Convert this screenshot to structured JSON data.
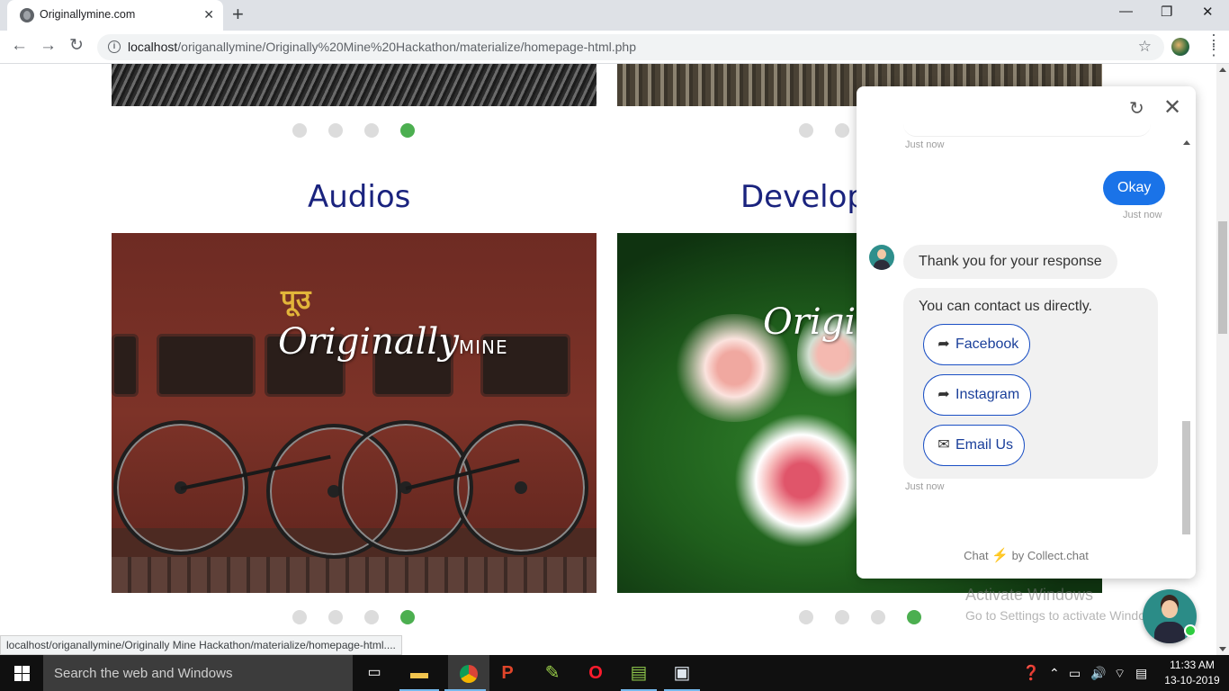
{
  "browser": {
    "tab_title": "Originallymine.com",
    "tab_close": "✕",
    "new_tab": "+",
    "url_host": "localhost",
    "url_path": "/origanallymine/Originally%20Mine%20Hackathon/materialize/homepage-html.php",
    "window_controls": [
      "—",
      "❐",
      "✕"
    ]
  },
  "page": {
    "sections": [
      {
        "title": "Audios",
        "carousel_dots": 4,
        "active_dot": 4
      },
      {
        "title": "Develope",
        "carousel_dots": 4,
        "active_dot": 4
      }
    ],
    "train_sign": "पूउ",
    "watermark_main": "Originally",
    "watermark_sub": "MINE",
    "watermark_partial": "Origi",
    "status_url": "localhost/origanallymine/Originally Mine Hackathon/materialize/homepage-html....",
    "activate_title": "Activate Windows",
    "activate_sub": "Go to Settings to activate Windo"
  },
  "chat": {
    "timestamp_1": "Just now",
    "user_message": "Okay",
    "timestamp_2": "Just now",
    "bot_message": "Thank you for your response",
    "bot_card_text": "You can contact us directly.",
    "links": [
      {
        "label": "Facebook",
        "icon": "share-icon"
      },
      {
        "label": "Instagram",
        "icon": "share-icon"
      },
      {
        "label": "Email Us",
        "icon": "mail-icon"
      }
    ],
    "timestamp_3": "Just now",
    "footer_prefix": "Chat",
    "footer_suffix": "by Collect.chat",
    "user_bubble_color": "#1a73e8"
  },
  "taskbar": {
    "search_placeholder": "Search the web and Windows",
    "time": "11:33 AM",
    "date": "13-10-2019"
  },
  "colors": {
    "title": "#1a237e",
    "active_dot": "#4caf50",
    "inactive_dot": "#dcdcdc"
  }
}
